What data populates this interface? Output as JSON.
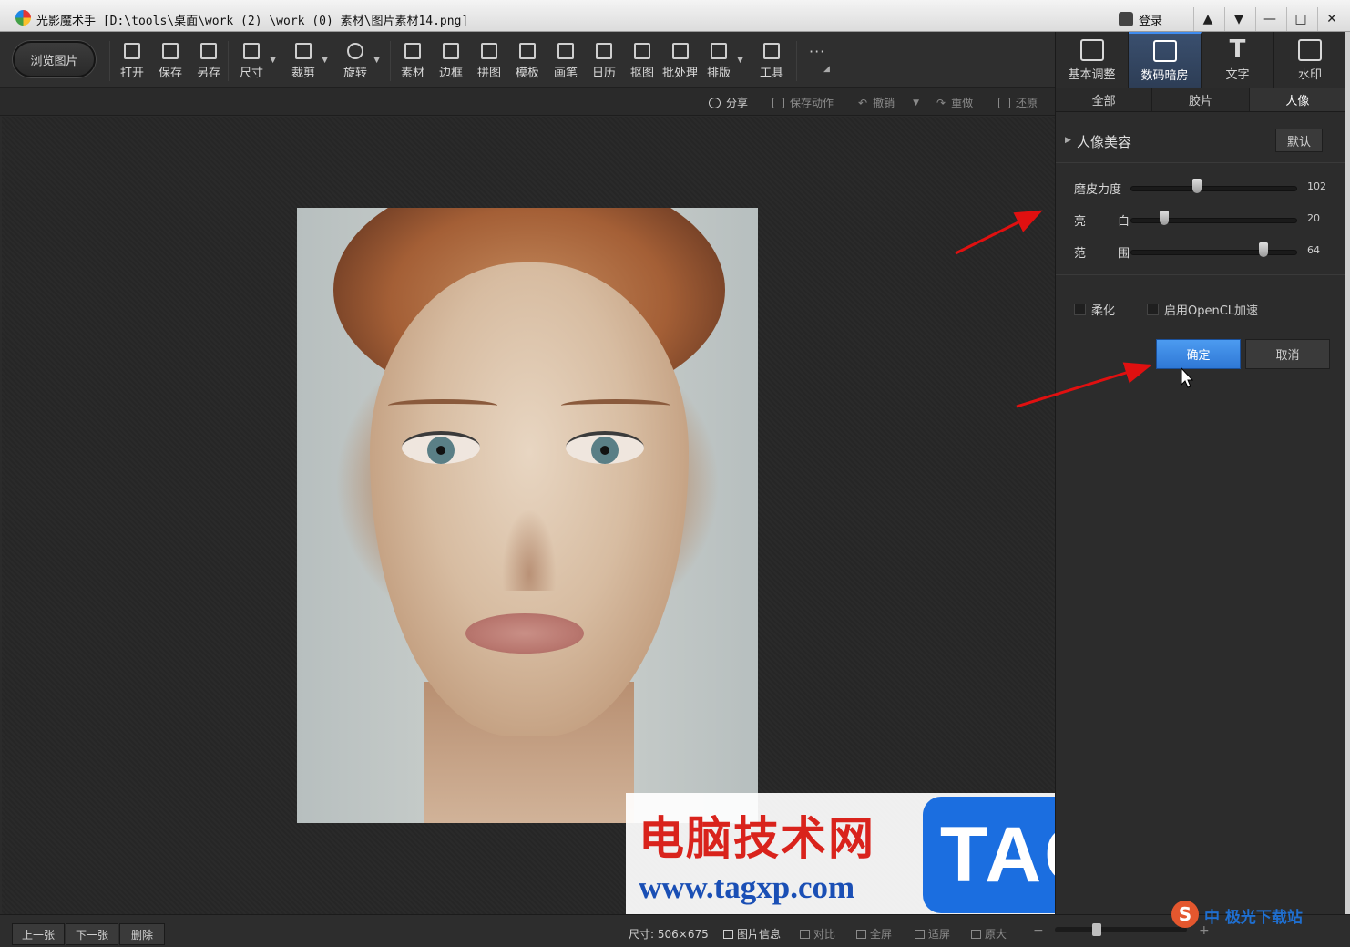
{
  "window": {
    "title": "光影魔术手 [D:\\tools\\桌面\\work (2) \\work (0) 素材\\图片素材14.png]",
    "login_label": "登录",
    "controls": [
      "▲",
      "▼",
      "—",
      "□",
      "✕"
    ]
  },
  "toolbar": {
    "browse_label": "浏览图片",
    "tools": [
      "打开",
      "保存",
      "另存",
      "尺寸",
      "裁剪",
      "旋转",
      "素材",
      "边框",
      "拼图",
      "模板",
      "画笔",
      "日历",
      "抠图",
      "批处理",
      "排版",
      "工具"
    ],
    "more_label": "···"
  },
  "actions": {
    "share": "分享",
    "save_action": "保存动作",
    "undo": "撤销",
    "redo": "重做",
    "restore": "还原"
  },
  "right_panel": {
    "tabs": [
      "基本调整",
      "数码暗房",
      "文字",
      "水印"
    ],
    "active_tab": "数码暗房",
    "subtabs": [
      "全部",
      "胶片",
      "人像"
    ],
    "active_subtab": "人像",
    "section_title": "人像美容",
    "default_label": "默认",
    "sliders": [
      {
        "label": "磨皮力度",
        "label2": "",
        "value": 102,
        "max": 255
      },
      {
        "label": "亮",
        "label2": "白",
        "value": 20,
        "max": 100
      },
      {
        "label": "范",
        "label2": "围",
        "value": 64,
        "max": 80
      }
    ],
    "checkbox_soften": "柔化",
    "checkbox_opencl": "启用OpenCL加速",
    "ok_label": "确定",
    "cancel_label": "取消"
  },
  "status": {
    "prev": "上一张",
    "next": "下一张",
    "delete": "删除",
    "size": "尺寸: 506×675",
    "info": "图片信息",
    "compare": "对比",
    "fullscreen": "全屏",
    "fit": "适屏",
    "original": "原大",
    "zoom_minus": "−",
    "zoom_plus": "+"
  },
  "watermark": {
    "cn": "电脑技术网",
    "url": "www.tagxp.com",
    "tag": "TAG"
  },
  "corner": {
    "s_letter": "S",
    "text": "中 极光下载站"
  },
  "colors": {
    "accent": "#3f8cf0",
    "ok_button": "#3a86e4",
    "arrow": "#e01010"
  }
}
